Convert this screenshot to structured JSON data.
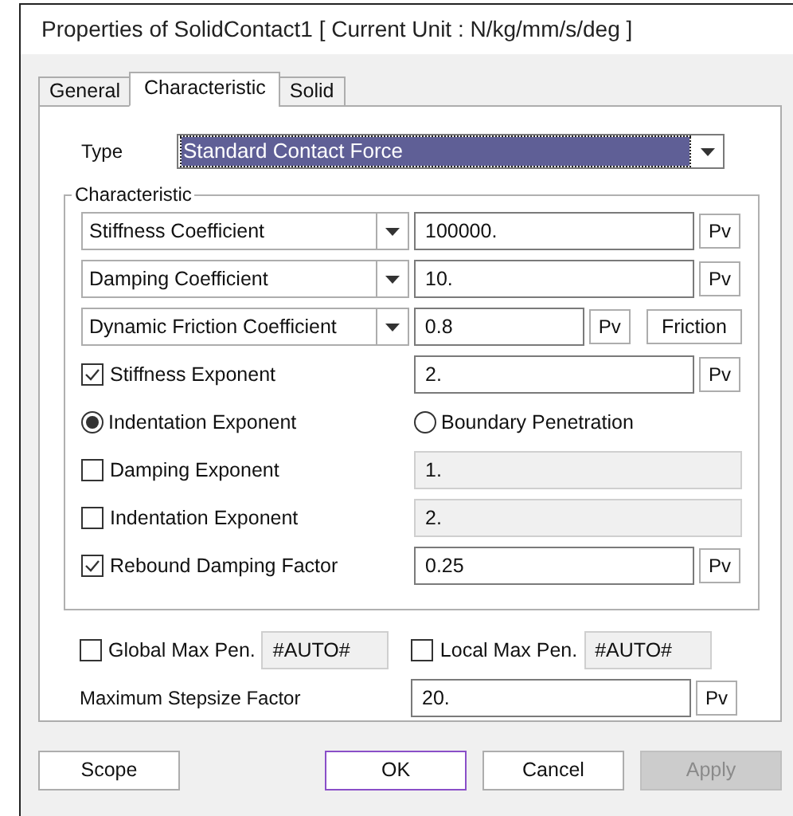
{
  "window": {
    "title": "Properties of SolidContact1 [ Current Unit : N/kg/mm/s/deg ]"
  },
  "tabs": [
    {
      "label": "General",
      "selected": false
    },
    {
      "label": "Characteristic",
      "selected": true
    },
    {
      "label": "Solid",
      "selected": false
    }
  ],
  "type": {
    "label": "Type",
    "value": "Standard Contact Force",
    "focused": true
  },
  "characteristic": {
    "title": "Characteristic",
    "rows": [
      {
        "kind": "combo",
        "selector": "Stiffness Coefficient",
        "value": "100000.",
        "pv": "Pv"
      },
      {
        "kind": "combo",
        "selector": "Damping Coefficient",
        "value": "10.",
        "pv": "Pv"
      },
      {
        "kind": "combo",
        "selector": "Dynamic Friction Coefficient",
        "value": "0.8",
        "pv": "Pv",
        "extra": "Friction"
      },
      {
        "kind": "check",
        "label": "Stiffness Exponent",
        "checked": true,
        "value": "2.",
        "disabled": false,
        "pv": "Pv"
      },
      {
        "kind": "radio",
        "options": [
          {
            "label": "Indentation Exponent",
            "selected": true
          },
          {
            "label": "Boundary Penetration",
            "selected": false
          }
        ]
      },
      {
        "kind": "check",
        "label": "Damping Exponent",
        "checked": false,
        "value": "1.",
        "disabled": true
      },
      {
        "kind": "check",
        "label": "Indentation Exponent",
        "checked": false,
        "value": "2.",
        "disabled": true
      },
      {
        "kind": "check",
        "label": "Rebound Damping Factor",
        "checked": true,
        "value": "0.25",
        "disabled": false,
        "pv": "Pv"
      }
    ]
  },
  "penetration": [
    {
      "label": "Global Max Pen.",
      "checked": false,
      "value": "#AUTO#",
      "disabled": true
    },
    {
      "label": "Local Max Pen.",
      "checked": false,
      "value": "#AUTO#",
      "disabled": true
    }
  ],
  "stepsize": {
    "label": "Maximum Stepsize Factor",
    "value": "20.",
    "pv": "Pv"
  },
  "buttons": [
    {
      "label": "Scope",
      "default": false,
      "disabled": false
    },
    {
      "label": "OK",
      "default": true,
      "disabled": false
    },
    {
      "label": "Cancel",
      "default": false,
      "disabled": false
    },
    {
      "label": "Apply",
      "default": false,
      "disabled": true
    }
  ]
}
